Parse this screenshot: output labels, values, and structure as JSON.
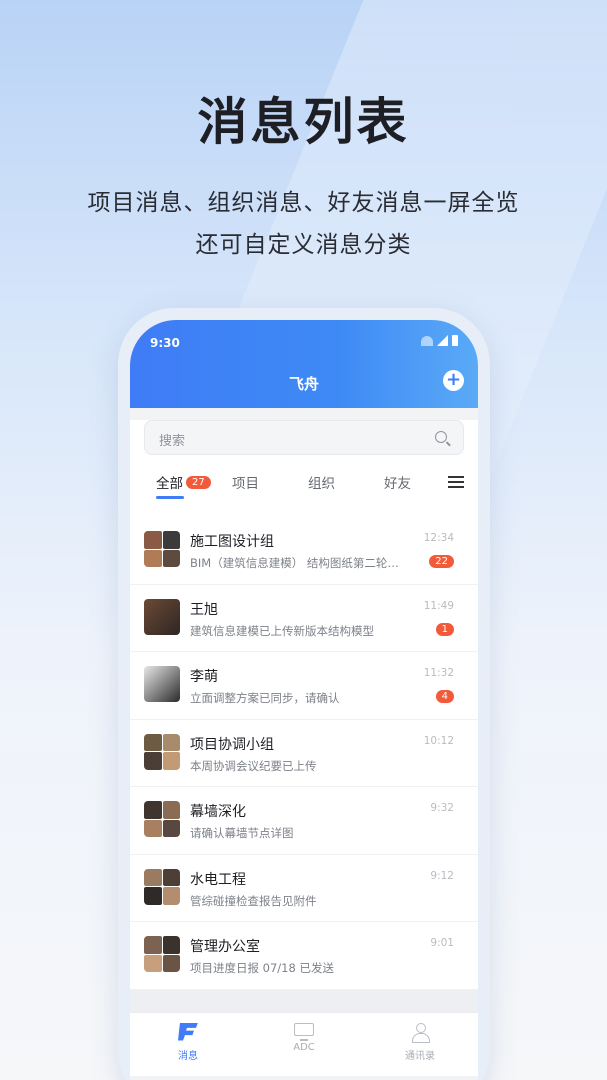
{
  "hero": {
    "title": "消息列表",
    "subtitle_line1": "项目消息、组织消息、好友消息一屏全览",
    "subtitle_line2": "还可自定义消息分类"
  },
  "status_bar": {
    "time": "9:30"
  },
  "app": {
    "title": "飞舟",
    "add_label": "+"
  },
  "search": {
    "placeholder": "搜索"
  },
  "tabs": {
    "all": "全部",
    "all_count": "27",
    "project": "项目",
    "org": "组织",
    "friend": "好友"
  },
  "messages": [
    {
      "name": "施工图设计组",
      "preview": "BIM（建筑信息建模） 结构图纸第二轮…",
      "time": "12:34",
      "unread": "22"
    },
    {
      "name": "王旭",
      "preview": "建筑信息建模已上传新版本结构模型",
      "time": "11:49",
      "unread": "1"
    },
    {
      "name": "李萌",
      "preview": "立面调整方案已同步，请确认",
      "time": "11:32",
      "unread": "4"
    },
    {
      "name": "项目协调小组",
      "preview": "本周协调会议纪要已上传",
      "time": "10:12",
      "unread": ""
    },
    {
      "name": "幕墙深化",
      "preview": "请确认幕墙节点详图",
      "time": "9:32",
      "unread": ""
    },
    {
      "name": "水电工程",
      "preview": "管综碰撞检查报告见附件",
      "time": "9:12",
      "unread": ""
    },
    {
      "name": "管理办公室",
      "preview": "项目进度日报 07/18 已发送",
      "time": "9:01",
      "unread": ""
    }
  ],
  "nav": {
    "messages": "消息",
    "adc": "ADC",
    "contacts": "通讯录"
  },
  "colors": {
    "accent": "#3f7cf6",
    "badge": "#f25a3a"
  }
}
